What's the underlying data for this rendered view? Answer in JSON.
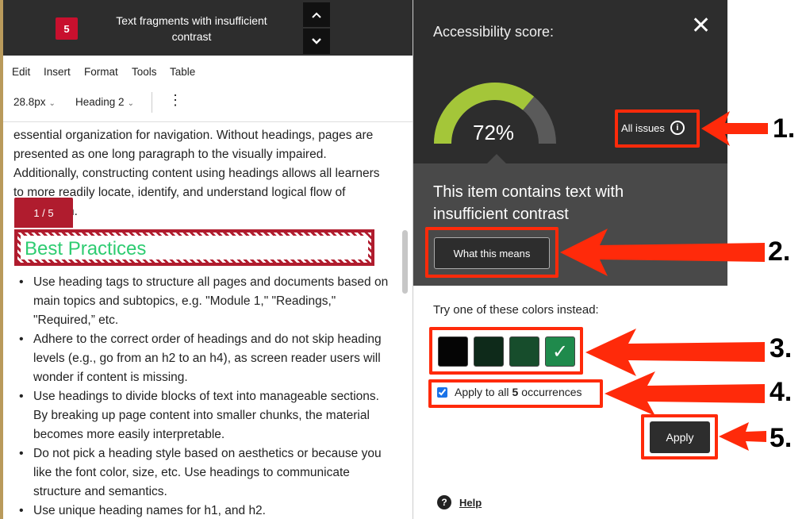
{
  "top_bar": {
    "issue_count": "5",
    "issue_title": "Text fragments with insufficient contrast",
    "nav_up_icon": "chevron-up-icon",
    "nav_down_icon": "chevron-down-icon"
  },
  "menu": {
    "items": [
      "Edit",
      "Insert",
      "Format",
      "Tools",
      "Table"
    ]
  },
  "toolbar": {
    "font_size": "28.8px",
    "block_format": "Heading 2",
    "more_icon": "vertical-ellipsis-icon"
  },
  "editor": {
    "intro": "essential organization for navigation. Without headings, pages are presented as one long paragraph to the visually impaired. Additionally, constructing content using headings allows all learners to more readily locate, identify, and understand logical flow of information.",
    "pager": "1 / 5",
    "heading": "Best Practices",
    "heading_color": "#2ecc71",
    "bullets": [
      "Use heading tags to structure all pages and documents based on main topics and subtopics, e.g. \"Module 1,\" \"Readings,\" \"Required,” etc.",
      "Adhere to the correct order of headings and do not skip heading levels (e.g., go from an h2 to an h4), as screen reader users will wonder if content is missing.",
      "Use headings to divide blocks of text into manageable sections. By breaking up page content into smaller chunks, the material becomes more easily interpretable.",
      "Do not pick a heading style based on aesthetics or because you like the font color, size, etc. Use headings to communicate structure and semantics.",
      "Use unique heading names for h1, and h2."
    ]
  },
  "panel": {
    "score_label": "Accessibility score:",
    "score_value": 72,
    "score_text": "72%",
    "close_icon": "close-icon",
    "all_issues": "All issues",
    "info_icon": "info-icon",
    "issue_description": "This item contains text with insufficient contrast",
    "what_this_means": "What this means",
    "try_colors_label": "Try one of these colors instead:",
    "swatches": [
      "#050505",
      "#0e2a1a",
      "#174d2c",
      "#1f8a4c"
    ],
    "selected_swatch": 3,
    "apply_all_prefix": "Apply to all",
    "apply_all_count": "5",
    "apply_all_suffix": "occurrences",
    "apply_all_checked": true,
    "apply": "Apply",
    "help": "Help",
    "help_icon": "question-icon"
  },
  "annotations": [
    "1.",
    "2.",
    "3.",
    "4.",
    "5."
  ],
  "colors": {
    "accent_red": "#ff2a0a",
    "error_red": "#c8102e",
    "gauge_fill": "#a4c639",
    "gauge_track": "#5a5a5a",
    "dark_panel": "#2d2d2d",
    "mid_panel": "#494949"
  }
}
